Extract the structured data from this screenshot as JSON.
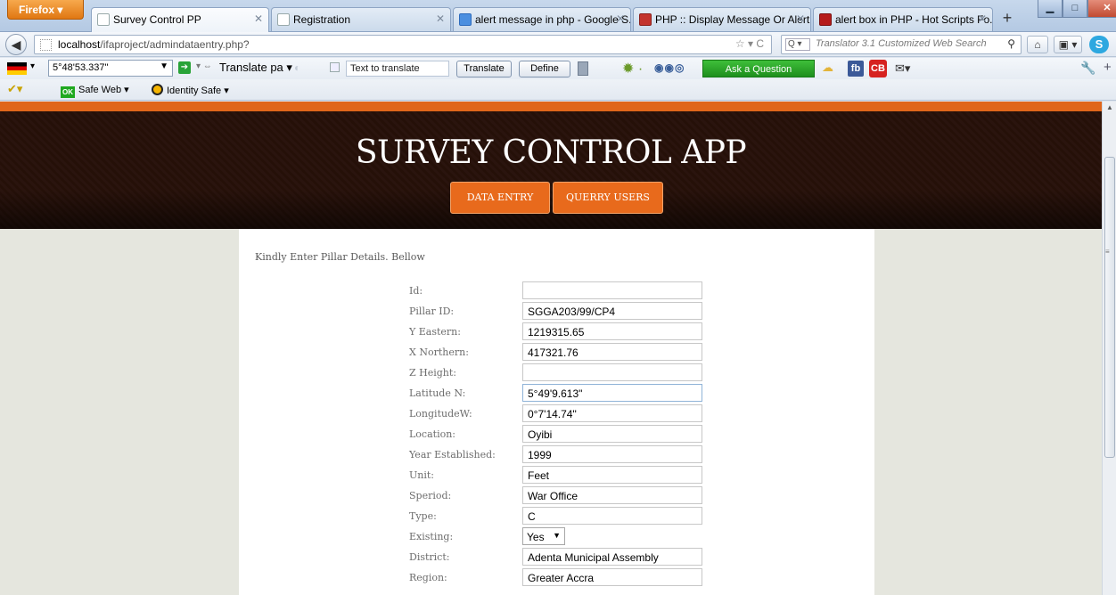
{
  "browser": {
    "app_button": "Firefox ▾",
    "tabs": [
      {
        "title": "Survey Control PP",
        "active": true
      },
      {
        "title": "Registration",
        "active": false
      },
      {
        "title": "alert message in php - Google S...",
        "active": false
      },
      {
        "title": "PHP :: Display Message Or Alert ...",
        "active": false
      },
      {
        "title": "alert box in PHP - Hot Scripts Fo...",
        "active": false
      }
    ],
    "url_host": "localhost",
    "url_path": "/ifaproject/admindataentry.php?",
    "search_placeholder": "Translator 3.1 Customized Web Search"
  },
  "toolbar": {
    "coord_value": "5°48'53.337\"",
    "translate_select": "Translate pa",
    "text_to_translate": "Text to translate",
    "translate_btn": "Translate",
    "define_btn": "Define",
    "ask_btn": "Ask a Question",
    "fb": "fb",
    "cb": "CB",
    "safe_web": "Safe Web ▾",
    "identity_safe": "Identity Safe ▾",
    "ok_badge": "OK"
  },
  "site": {
    "title": "SURVEY CONTROL APP",
    "nav": [
      "DATA ENTRY",
      "QUERRY USERS"
    ],
    "intro": "Kindly Enter Pillar Details. Bellow"
  },
  "form": {
    "id_label": "Id:",
    "id_value": "",
    "pillar_label": "Pillar ID:",
    "pillar_value": "SGGA203/99/CP4",
    "y_label": "Y Eastern:",
    "y_value": "1219315.65",
    "x_label": "X Northern:",
    "x_value": "417321.76",
    "z_label": "Z Height:",
    "z_value": "",
    "lat_label": "Latitude N:",
    "lat_value": "5°49'9.613\"",
    "lon_label": "LongitudeW:",
    "lon_value": "0°7'14.74\"",
    "loc_label": "Location:",
    "loc_value": "Oyibi",
    "year_label": "Year Established:",
    "year_value": "1999",
    "unit_label": "Unit:",
    "unit_value": "Feet",
    "speriod_label": "Speriod:",
    "speriod_value": "War Office",
    "type_label": "Type:",
    "type_value": "C",
    "existing_label": "Existing:",
    "existing_value": "Yes",
    "district_label": "District:",
    "district_value": "Adenta Municipal Assembly",
    "region_label": "Region:",
    "region_value": "Greater Accra"
  }
}
